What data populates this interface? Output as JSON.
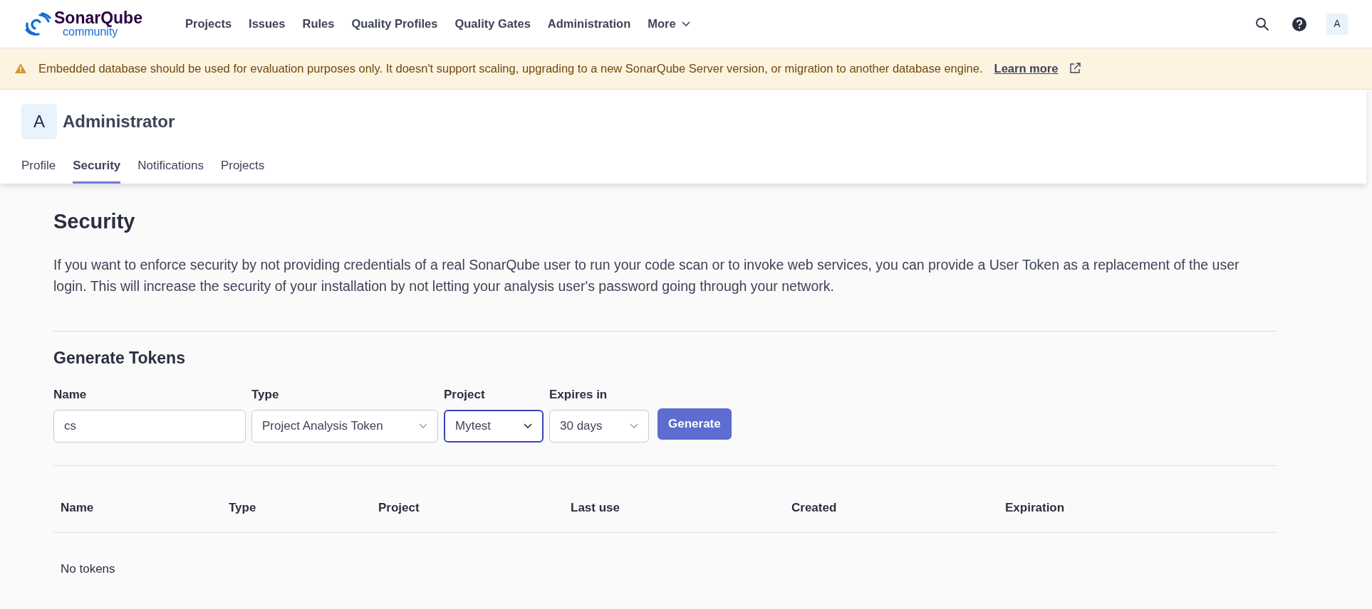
{
  "header": {
    "logo": {
      "name": "SonarQube",
      "edition": "community"
    },
    "nav": [
      {
        "label": "Projects",
        "dropdown": false
      },
      {
        "label": "Issues",
        "dropdown": false
      },
      {
        "label": "Rules",
        "dropdown": false
      },
      {
        "label": "Quality Profiles",
        "dropdown": false
      },
      {
        "label": "Quality Gates",
        "dropdown": false
      },
      {
        "label": "Administration",
        "dropdown": false
      },
      {
        "label": "More",
        "dropdown": true
      }
    ],
    "avatar": "A"
  },
  "banner": {
    "message": "Embedded database should be used for evaluation purposes only. It doesn't support scaling, upgrading to a new SonarQube Server version, or migration to another database engine.",
    "link": "Learn more"
  },
  "account": {
    "avatar": "A",
    "name": "Administrator",
    "tabs": [
      {
        "label": "Profile",
        "selected": false
      },
      {
        "label": "Security",
        "selected": true
      },
      {
        "label": "Notifications",
        "selected": false
      },
      {
        "label": "Projects",
        "selected": false
      }
    ]
  },
  "security": {
    "title": "Security",
    "description": "If you want to enforce security by not providing credentials of a real SonarQube user to run your code scan or to invoke web services, you can provide a User Token as a replacement of the user login. This will increase the security of your installation by not letting your analysis user's password going through your network.",
    "generate_title": "Generate Tokens",
    "fields": [
      {
        "kind": "input",
        "label": "Name",
        "value": "cs",
        "focused": false
      },
      {
        "kind": "select",
        "label": "Type",
        "value": "Project Analysis Token",
        "focused": false
      },
      {
        "kind": "select",
        "label": "Project",
        "value": "Mytest",
        "focused": true
      },
      {
        "kind": "select",
        "label": "Expires in",
        "value": "30 days",
        "focused": false
      }
    ],
    "generate_button": "Generate",
    "table": {
      "columns": [
        "Name",
        "Type",
        "Project",
        "Last use",
        "Created",
        "Expiration"
      ],
      "empty": "No tokens"
    }
  }
}
